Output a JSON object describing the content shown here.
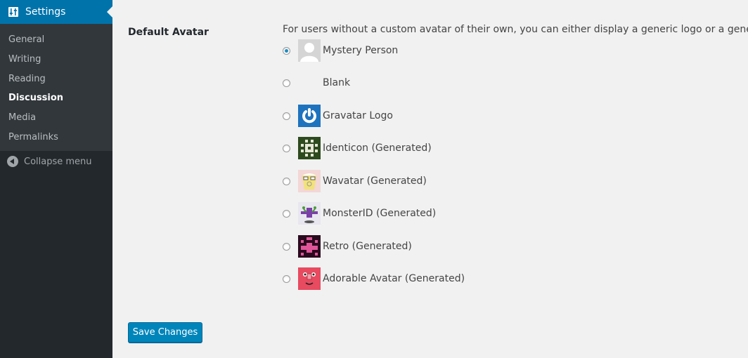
{
  "sidebar": {
    "header": {
      "label": "Settings",
      "icon": "settings-icon"
    },
    "items": [
      {
        "label": "General",
        "current": false
      },
      {
        "label": "Writing",
        "current": false
      },
      {
        "label": "Reading",
        "current": false
      },
      {
        "label": "Discussion",
        "current": true
      },
      {
        "label": "Media",
        "current": false
      },
      {
        "label": "Permalinks",
        "current": false
      }
    ],
    "collapse_label": "Collapse menu"
  },
  "main": {
    "field_label": "Default Avatar",
    "description": "For users without a custom avatar of their own, you can either display a generic logo or a generated one based on their email address.",
    "avatars": [
      {
        "label": "Mystery Person",
        "checked": true,
        "icon": "mystery-person-avatar"
      },
      {
        "label": "Blank",
        "checked": false,
        "icon": "blank-avatar"
      },
      {
        "label": "Gravatar Logo",
        "checked": false,
        "icon": "gravatar-logo-avatar"
      },
      {
        "label": "Identicon (Generated)",
        "checked": false,
        "icon": "identicon-avatar"
      },
      {
        "label": "Wavatar (Generated)",
        "checked": false,
        "icon": "wavatar-avatar"
      },
      {
        "label": "MonsterID (Generated)",
        "checked": false,
        "icon": "monsterid-avatar"
      },
      {
        "label": "Retro (Generated)",
        "checked": false,
        "icon": "retro-avatar"
      },
      {
        "label": "Adorable Avatar (Generated)",
        "checked": false,
        "icon": "adorable-avatar"
      }
    ],
    "save_label": "Save Changes"
  },
  "colors": {
    "sidebar_bg": "#23282d",
    "submenu_bg": "#32373c",
    "accent": "#0073aa",
    "button": "#0085ba",
    "page_bg": "#f1f1f1"
  }
}
